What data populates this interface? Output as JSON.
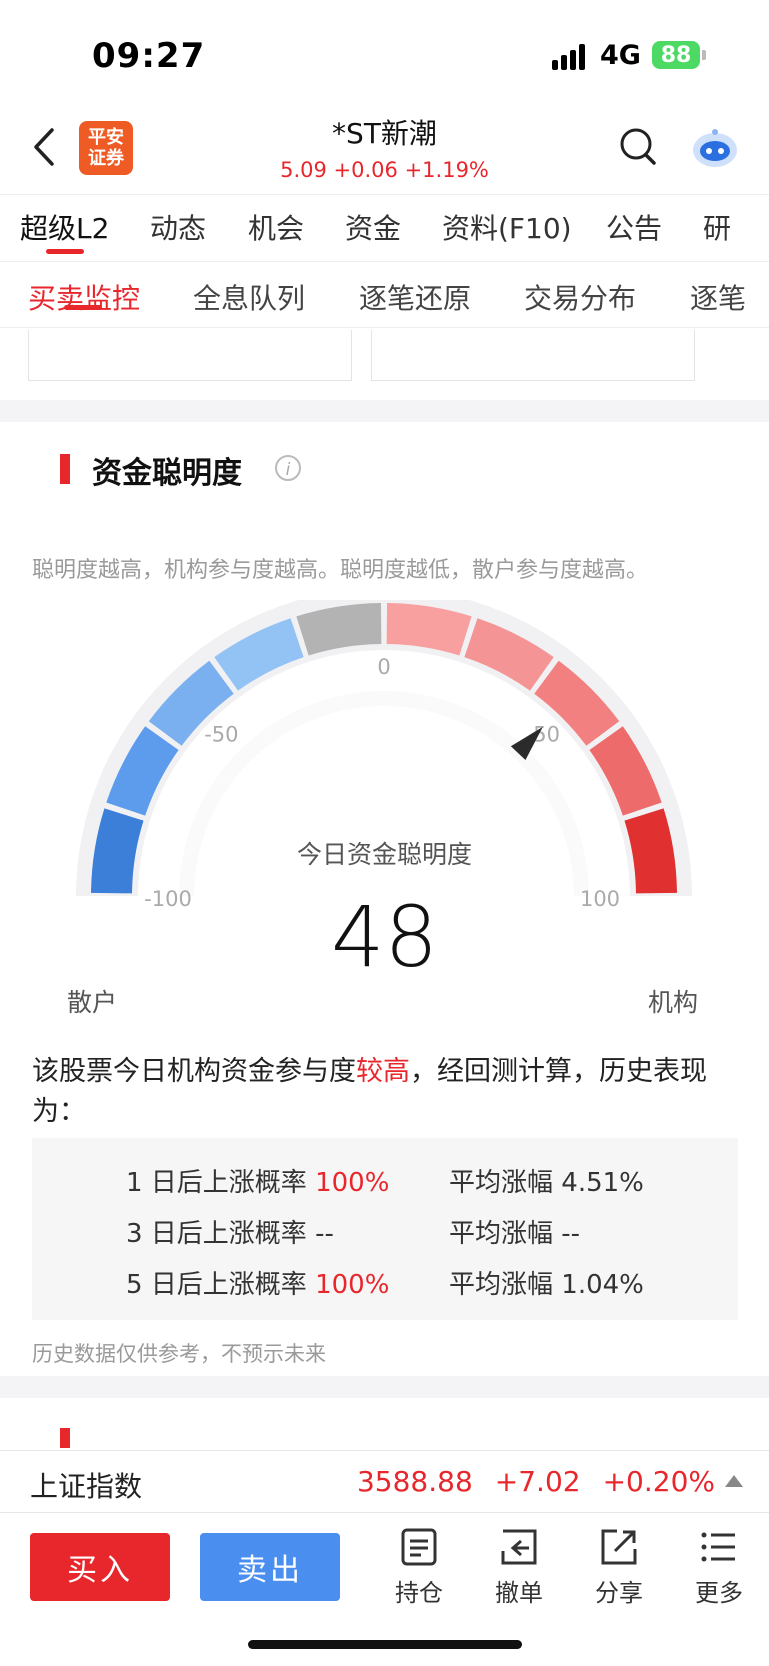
{
  "status_bar": {
    "time": "09:27",
    "network": "4G",
    "battery": "88"
  },
  "header": {
    "logo_line1": "平安",
    "logo_line2": "证券",
    "stock_name": "*ST新潮",
    "quote": "5.09 +0.06 +1.19%"
  },
  "main_tabs": [
    {
      "label": "超级L2"
    },
    {
      "label": "动态"
    },
    {
      "label": "机会"
    },
    {
      "label": "资金"
    },
    {
      "label": "资料(F10)"
    },
    {
      "label": "公告"
    },
    {
      "label": "研"
    }
  ],
  "sub_tabs": [
    {
      "label": "买卖监控"
    },
    {
      "label": "全息队列"
    },
    {
      "label": "逐笔还原"
    },
    {
      "label": "交易分布"
    },
    {
      "label": "逐笔"
    }
  ],
  "section": {
    "title": "资金聪明度",
    "info": "i",
    "description": "聪明度越高，机构参与度越高。聪明度越低，散户参与度越高。"
  },
  "gauge": {
    "center_label": "今日资金聪明度",
    "value": "48",
    "needle_value": 48,
    "min": -100,
    "max": 100,
    "tick_labels": [
      "-100",
      "-50",
      "0",
      "50",
      "100"
    ],
    "left_label": "散户",
    "right_label": "机构",
    "segment_colors": [
      "#3b7fd9",
      "#5d9cec",
      "#7bb0f0",
      "#93c2f5",
      "#b3b3b3",
      "#f8a0a0",
      "#f59494",
      "#f28080",
      "#ee6b6b",
      "#e0302f"
    ]
  },
  "conclusion": {
    "prefix": "该股票今日机构资金参与度",
    "highlight": "较高",
    "suffix": "，经回测计算，历史表现为："
  },
  "probability_table": [
    {
      "label": "1 日后上涨概率",
      "prob": "100%",
      "avg_label": "平均涨幅",
      "avg": "4.51%"
    },
    {
      "label": "3 日后上涨概率",
      "prob": "--",
      "avg_label": "平均涨幅",
      "avg": "--"
    },
    {
      "label": "5 日后上涨概率",
      "prob": "100%",
      "avg_label": "平均涨幅",
      "avg": "1.04%"
    }
  ],
  "disclaimer": "历史数据仅供参考，不预示未来",
  "index_bar": {
    "name": "上证指数",
    "value": "3588.88",
    "change": "+7.02",
    "percent": "+0.20%"
  },
  "actions": {
    "buy": "买入",
    "sell": "卖出",
    "items": [
      {
        "label": "持仓",
        "icon": "document-icon"
      },
      {
        "label": "撤单",
        "icon": "undo-icon"
      },
      {
        "label": "分享",
        "icon": "share-icon"
      },
      {
        "label": "更多",
        "icon": "menu-icon"
      }
    ]
  }
}
